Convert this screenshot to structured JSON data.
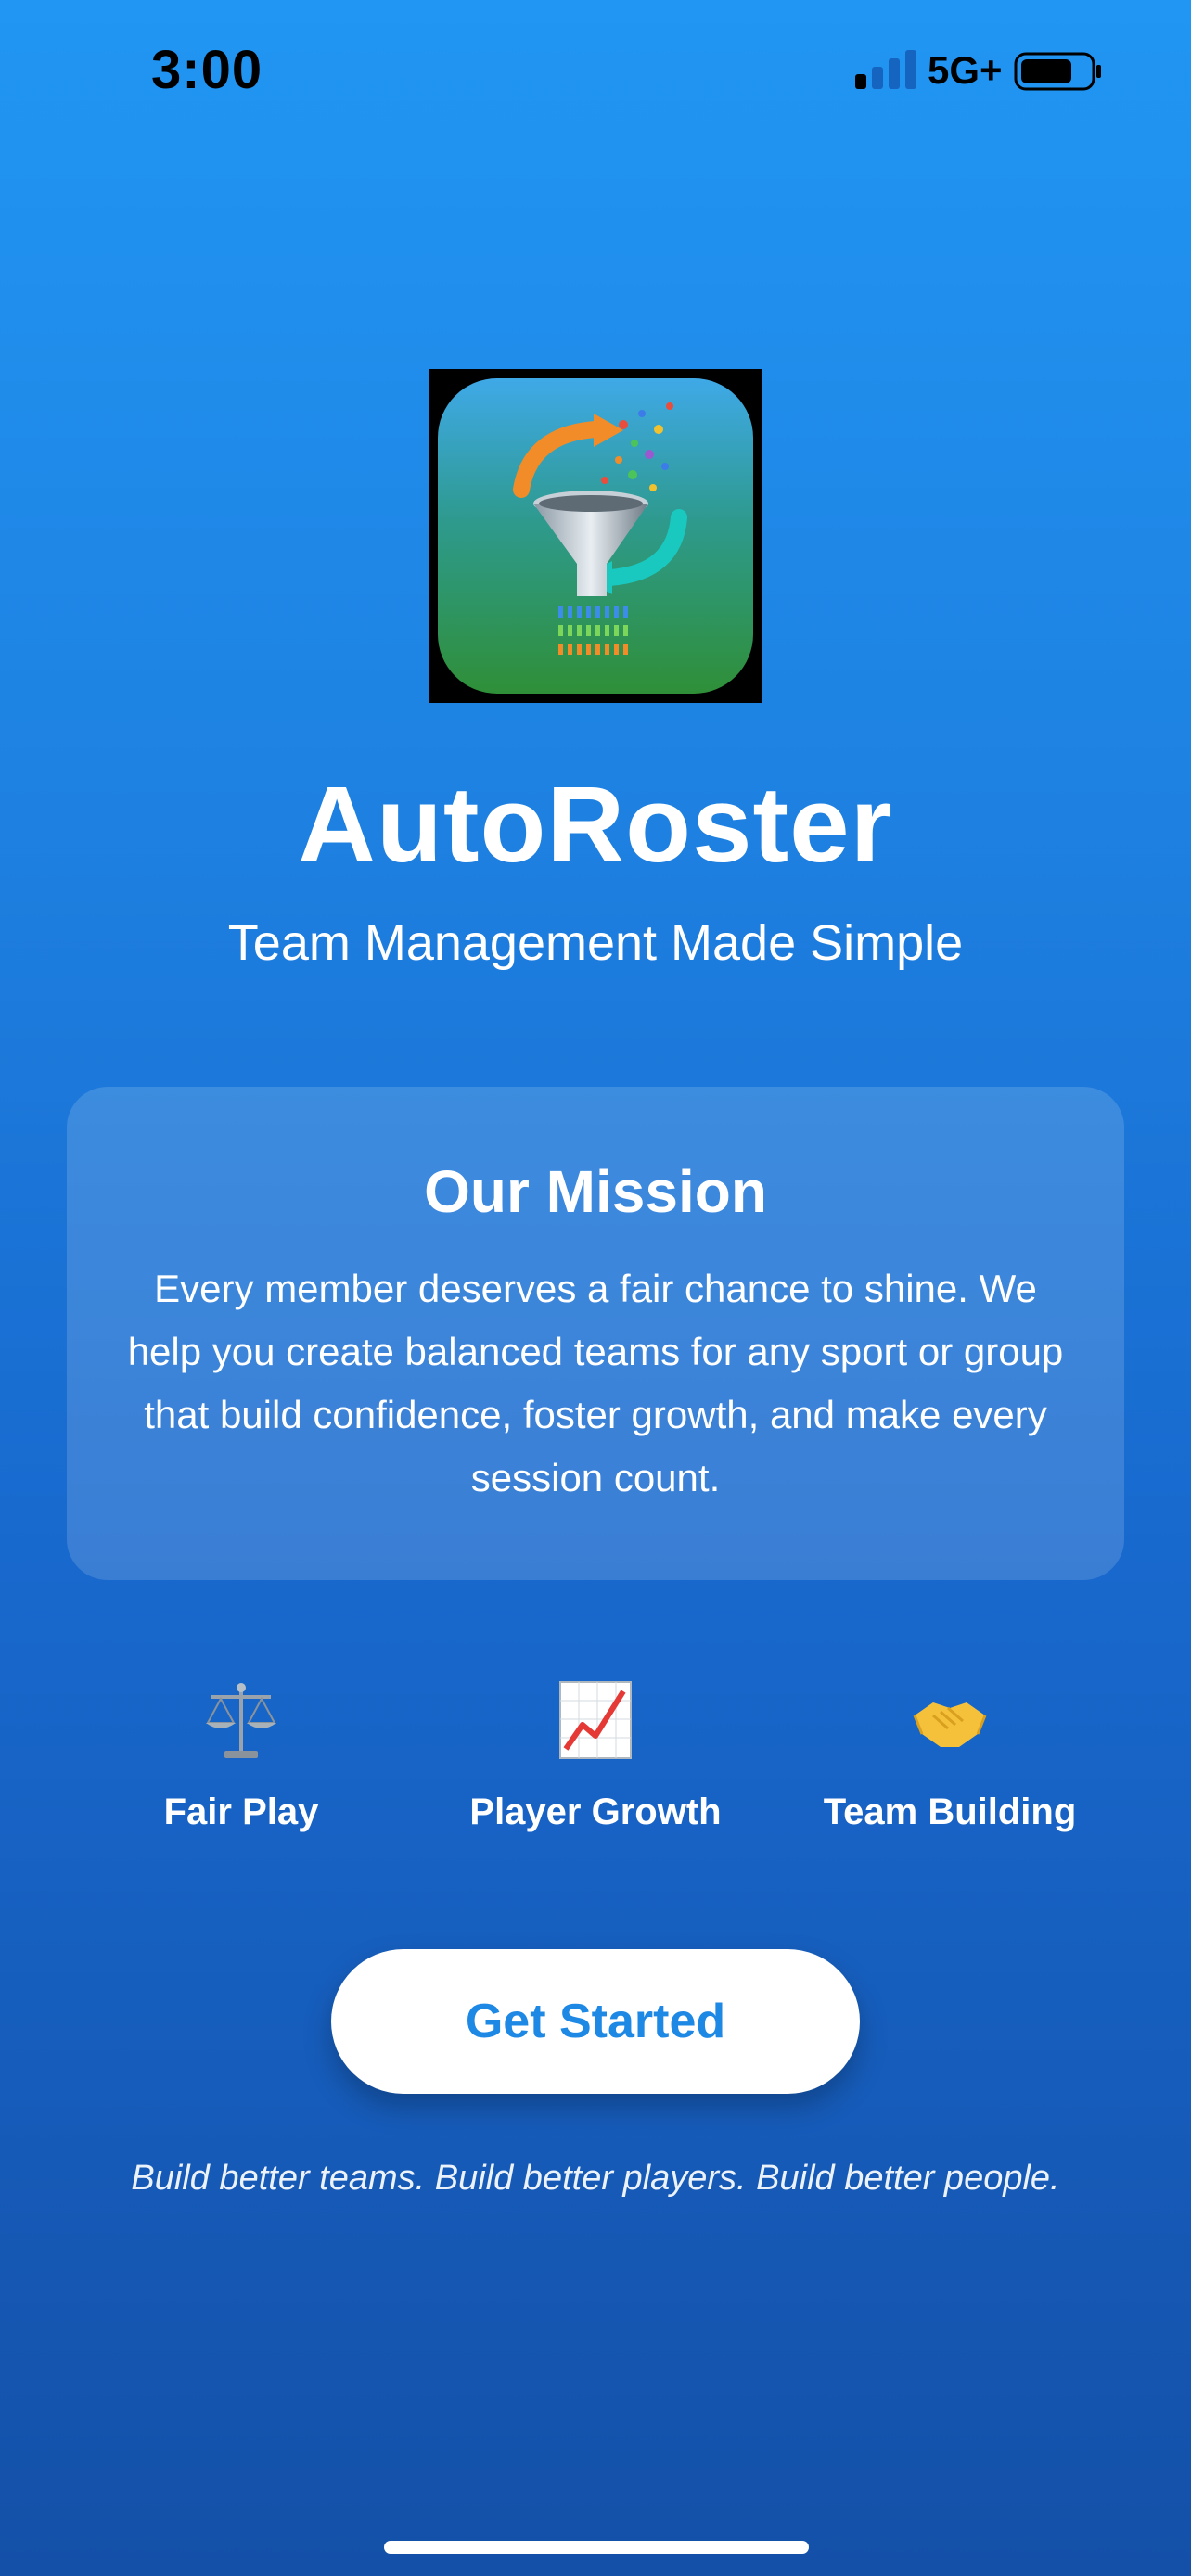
{
  "status_bar": {
    "time": "3:00",
    "network": "5G+",
    "icons": [
      "signal-icon",
      "battery-icon"
    ]
  },
  "app": {
    "icon": "app-logo-funnel-icon",
    "title": "AutoRoster",
    "subtitle": "Team Management Made Simple"
  },
  "mission": {
    "title": "Our Mission",
    "text": "Every member deserves a fair chance to shine. We help you create balanced teams for any sport or group that build confidence, foster growth, and make every session count."
  },
  "features": [
    {
      "icon": "scales-icon",
      "label": "Fair Play"
    },
    {
      "icon": "chart-increasing-icon",
      "label": "Player Growth"
    },
    {
      "icon": "handshake-icon",
      "label": "Team Building"
    }
  ],
  "cta": {
    "label": "Get Started"
  },
  "tagline": "Build better teams. Build better players. Build better people.",
  "colors": {
    "gradient_top": "#2196F3",
    "gradient_bottom": "#1450A8",
    "button_text": "#1E88E5",
    "button_bg": "#FFFFFF"
  }
}
